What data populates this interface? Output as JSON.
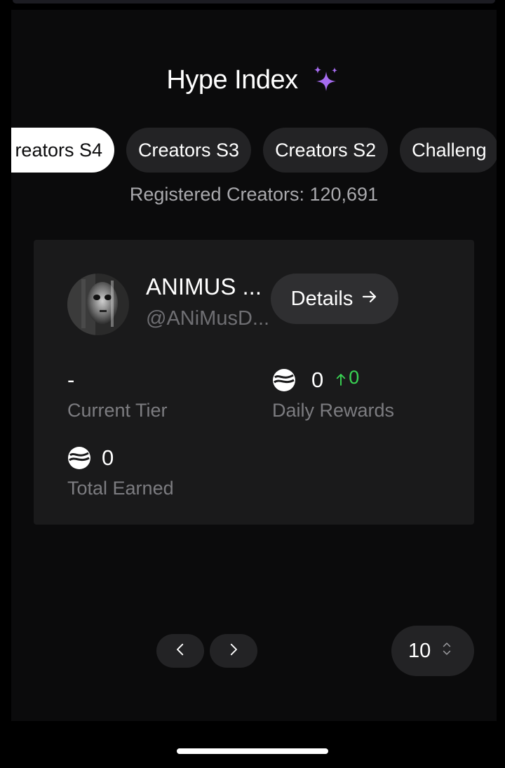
{
  "header": {
    "title": "Hype Index",
    "title_icon": "sparkles-icon",
    "accent_color": "#a66cf0"
  },
  "tabs": [
    {
      "label": "reators S4",
      "active": true
    },
    {
      "label": "Creators S3",
      "active": false
    },
    {
      "label": "Creators S2",
      "active": false
    },
    {
      "label": "Challeng",
      "active": false
    }
  ],
  "registered_text": "Registered Creators: 120,691",
  "card": {
    "name": "ANIMUS ...",
    "handle": "@ANiMusD...",
    "details_label": "Details",
    "details_icon": "arrow-right-icon",
    "current_tier": {
      "value": "-",
      "label": "Current Tier"
    },
    "daily_rewards": {
      "value": "0",
      "delta": "0",
      "label": "Daily Rewards",
      "icon": "coin-icon"
    },
    "total_earned": {
      "value": "0",
      "label": "Total Earned",
      "icon": "coin-icon"
    },
    "delta_color": "#39d353"
  },
  "pagination": {
    "prev_icon": "chevron-left-icon",
    "next_icon": "chevron-right-icon",
    "page_size": "10",
    "page_size_icon": "updown-chevron-icon"
  }
}
